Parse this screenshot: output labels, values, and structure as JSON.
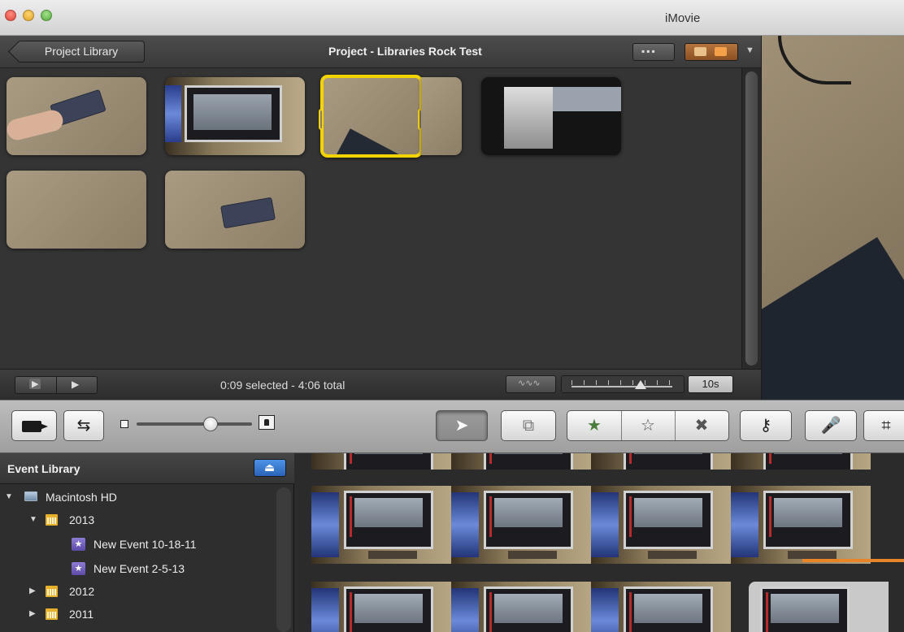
{
  "window": {
    "app_title": "iMovie"
  },
  "project": {
    "back_label": "Project Library",
    "title": "Project - Libraries Rock Test",
    "status_text": "0:09 selected - 4:06 total",
    "zoom_value": "10s"
  },
  "sidebar": {
    "title": "Event Library",
    "tree": [
      {
        "label": "Macintosh HD",
        "expanded": true
      },
      {
        "label": "2013",
        "expanded": true
      },
      {
        "label": "New Event 10-18-11"
      },
      {
        "label": "New Event 2-5-13"
      },
      {
        "label": "2012",
        "expanded": false
      },
      {
        "label": "2011",
        "expanded": false
      }
    ]
  },
  "toolbar": {
    "tools": [
      "camera-import",
      "swap-libraries",
      "select-arrow",
      "add-to-project",
      "mark-favorite",
      "unmark",
      "reject",
      "keyword",
      "voiceover",
      "crop"
    ]
  },
  "colors": {
    "selection": "#f4d400",
    "accent_blue": "#2a63b8",
    "event_purple": "#5d4aa6",
    "calendar_gold": "#e6b02b"
  }
}
